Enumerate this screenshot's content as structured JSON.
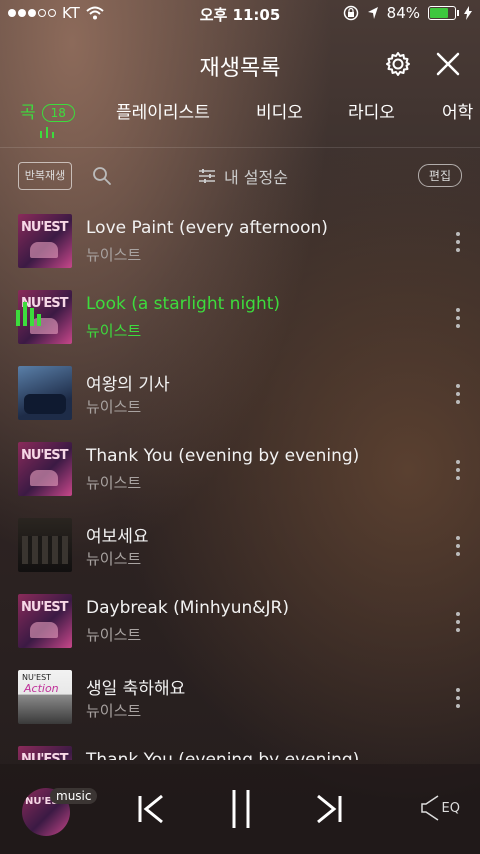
{
  "status": {
    "carrier": "KT",
    "time": "오후 11:05",
    "battery_percent": "84%",
    "battery_level": 0.84
  },
  "header": {
    "title": "재생목록"
  },
  "tabs": [
    {
      "label": "곡",
      "badge": "18",
      "active": true
    },
    {
      "label": "플레이리스트"
    },
    {
      "label": "비디오"
    },
    {
      "label": "라디오"
    },
    {
      "label": "어학"
    }
  ],
  "toolbar": {
    "repeat_label": "반복재생",
    "sort_label": "내 설정순",
    "edit_label": "편집"
  },
  "tracks": [
    {
      "title": "Love Paint (every afternoon)",
      "artist": "뉴이스트",
      "art": "nuest"
    },
    {
      "title": "Look (a starlight night)",
      "artist": "뉴이스트",
      "art": "nuest",
      "playing": true
    },
    {
      "title": "여왕의 기사",
      "artist": "뉴이스트",
      "art": "queen"
    },
    {
      "title": "Thank You (evening by evening)",
      "artist": "뉴이스트",
      "art": "nuest"
    },
    {
      "title": "여보세요",
      "artist": "뉴이스트",
      "art": "hello"
    },
    {
      "title": "Daybreak (Minhyun&JR)",
      "artist": "뉴이스트",
      "art": "nuest"
    },
    {
      "title": "생일 축하해요",
      "artist": "뉴이스트",
      "art": "action"
    },
    {
      "title": "Thank You (evening by evening)",
      "artist": "",
      "art": "nuest"
    }
  ],
  "player": {
    "badge": "music",
    "eq_label": "EQ"
  },
  "colors": {
    "accent": "#3ddc3d"
  }
}
